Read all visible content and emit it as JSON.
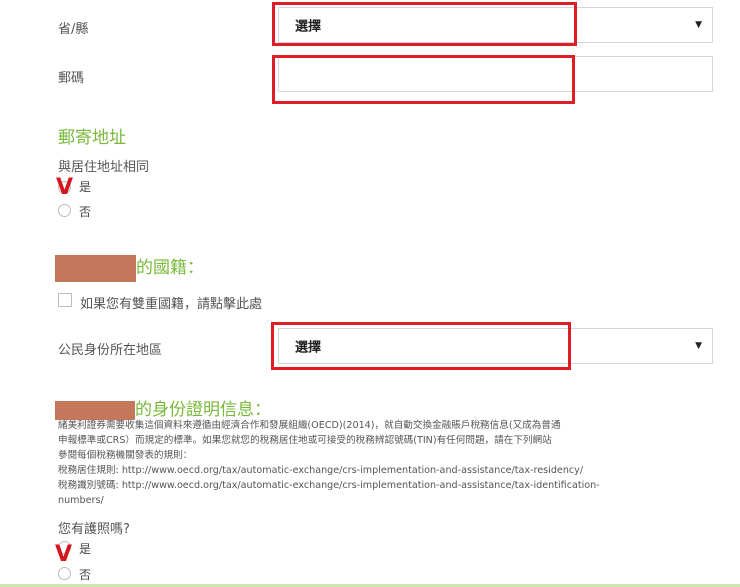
{
  "address": {
    "province_label": "省/縣",
    "province_value": "選擇",
    "postal_label": "郵碼",
    "postal_value": ""
  },
  "mailing": {
    "heading": "郵寄地址",
    "same_as_residential_label": "與居住地址相同",
    "options": [
      "是",
      "否"
    ],
    "selected": "是"
  },
  "nationality": {
    "heading_suffix": "的國籍：",
    "dual_nationality_label": "如果您有雙重國籍，請點擊此處",
    "citizen_region_label": "公民身份所在地區",
    "citizen_region_value": "選擇"
  },
  "identity": {
    "heading_suffix": "的身份證明信息：",
    "lines": [
      "緒美利證券需要收集這個資料來遵循由經濟合作和發展組織(OECD)(2014)，就自動交換金融賬戶稅務信息(又成為普通",
      "申報標準或CRS）而規定的標準。如果您就您的稅務居住地或可接受的稅務辨認號碼(TIN)有任何問題，請在下列網站",
      "參閱每個稅務機關發表的規則：",
      "稅務居住規則: http://www.oecd.org/tax/automatic-exchange/crs-implementation-and-assistance/tax-residency/",
      "稅務識別號碼: http://www.oecd.org/tax/automatic-exchange/crs-implementation-and-assistance/tax-identification-",
      "numbers/"
    ],
    "passport_question": "您有護照嗎?",
    "options": [
      "是",
      "否"
    ],
    "selected": "是"
  },
  "annotation_mark": "V",
  "icons": {
    "caret": "caret-down-icon"
  },
  "colors": {
    "section_green": "#79b93a",
    "highlight_red": "#e01c24",
    "redaction": "#c4775a"
  }
}
